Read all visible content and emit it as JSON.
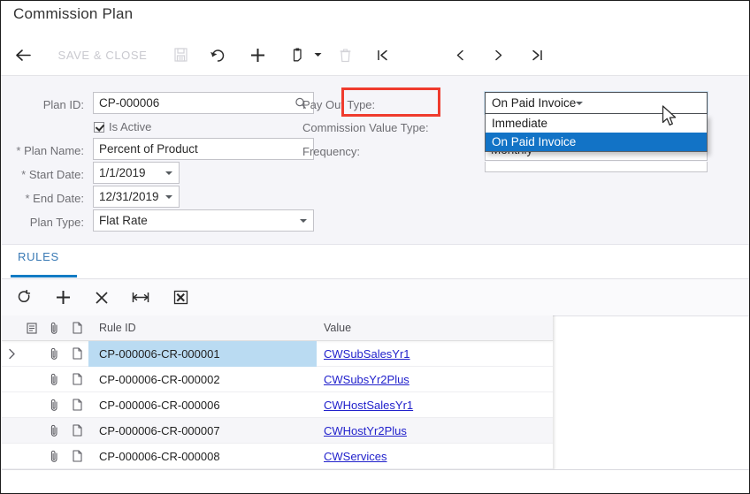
{
  "window": {
    "title": "Commission Plan"
  },
  "toolbar": {
    "back_icon": "arrow-left-icon",
    "save_close_label": "SAVE & CLOSE",
    "save_icon": "save-icon",
    "undo_icon": "undo-icon",
    "add_icon": "plus-icon",
    "copy_icon": "clipboard-icon",
    "copy_caret": "chevron-down-icon",
    "delete_icon": "trash-icon",
    "first_icon": "first-record-icon",
    "prev_icon": "previous-record-icon",
    "next_icon": "next-record-icon",
    "last_icon": "last-record-icon"
  },
  "form": {
    "left": {
      "plan_id_label": "Plan ID:",
      "plan_id_value": "CP-000006",
      "plan_id_search_icon": "magnifier-icon",
      "is_active_label": "Is Active",
      "is_active_checked": true,
      "plan_name_label": "Plan Name:",
      "plan_name_value": "Percent of Product",
      "start_date_label": "Start Date:",
      "start_date_value": "1/1/2019",
      "end_date_label": "End Date:",
      "end_date_value": "12/31/2019",
      "plan_type_label": "Plan Type:",
      "plan_type_value": "Flat Rate",
      "required_marker": "*"
    },
    "right": {
      "pay_out_type_label": "Pay Out Type:",
      "pay_out_type_value": "On Paid Invoice",
      "commission_value_type_label": "Commission Value Type:",
      "frequency_label": "Frequency:",
      "frequency_value": "Monthly"
    },
    "dropdown": {
      "open": true,
      "options": [
        "Immediate",
        "On Paid Invoice"
      ],
      "selected": "On Paid Invoice"
    },
    "annotation": {
      "color": "#ef3b2d",
      "target": "Pay Out Type:"
    }
  },
  "tabs": {
    "items": [
      {
        "label": "RULES",
        "active": true
      }
    ]
  },
  "grid_toolbar": {
    "refresh_icon": "refresh-icon",
    "add_row_icon": "plus-icon",
    "delete_row_icon": "close-x-icon",
    "fit_columns_icon": "fit-columns-icon",
    "export_excel_icon": "export-to-excel-icon"
  },
  "grid": {
    "columns": {
      "note_icon": "notes-icon",
      "clip_icon": "paperclip-icon",
      "file_icon": "file-icon",
      "rule_id": "Rule ID",
      "value": "Value"
    },
    "rows": [
      {
        "expand": "›",
        "clip_icon": "paperclip-icon",
        "file_icon": "file-icon",
        "rule_id": "CP-000006-CR-000001",
        "value": "CWSubSalesYr1",
        "selected": true
      },
      {
        "expand": "",
        "clip_icon": "paperclip-icon",
        "file_icon": "file-icon",
        "rule_id": "CP-000006-CR-000002",
        "value": "CWSubsYr2Plus",
        "selected": false
      },
      {
        "expand": "",
        "clip_icon": "paperclip-icon",
        "file_icon": "file-icon",
        "rule_id": "CP-000006-CR-000006",
        "value": "CWHostSalesYr1",
        "selected": false
      },
      {
        "expand": "",
        "clip_icon": "paperclip-icon",
        "file_icon": "file-icon",
        "rule_id": "CP-000006-CR-000007",
        "value": "CWHostYr2Plus",
        "selected": false
      },
      {
        "expand": "",
        "clip_icon": "paperclip-icon",
        "file_icon": "file-icon",
        "rule_id": "CP-000006-CR-000008",
        "value": "CWServices",
        "selected": false
      }
    ]
  },
  "colors": {
    "accent": "#137bc4",
    "highlight_select": "#1273c6",
    "row_select": "#badbf2",
    "link": "#2222cc",
    "annotation": "#ef3b2d"
  }
}
